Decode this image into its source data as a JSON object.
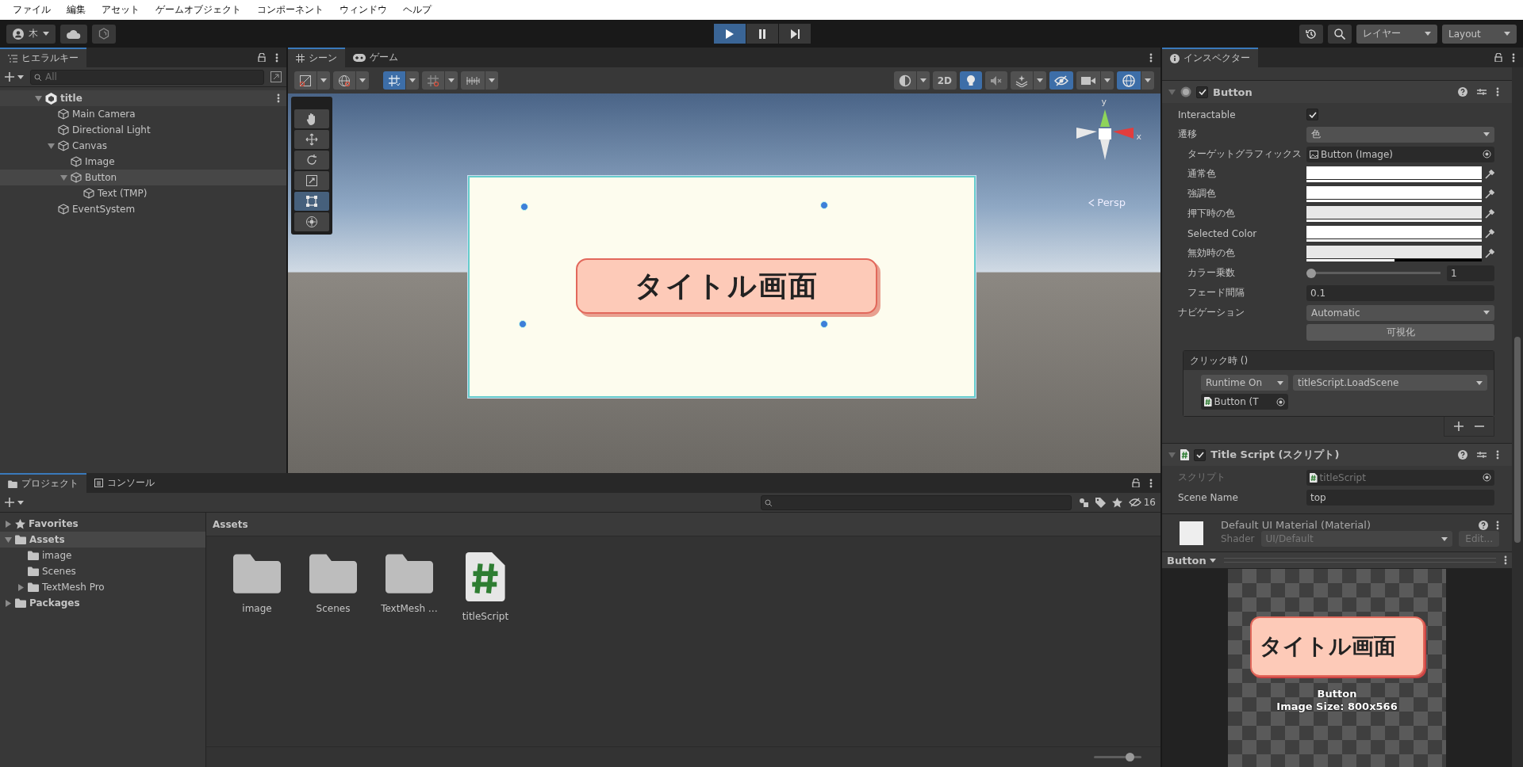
{
  "menu": [
    "ファイル",
    "編集",
    "アセット",
    "ゲームオブジェクト",
    "コンポーネント",
    "ウィンドウ",
    "ヘルプ"
  ],
  "toolbar": {
    "account": "木",
    "play_controls": [
      {
        "kind": "play",
        "selected": true
      },
      {
        "kind": "pause",
        "selected": false
      },
      {
        "kind": "step",
        "selected": false
      }
    ],
    "layers": "レイヤー",
    "layout": "Layout"
  },
  "hierarchy": {
    "tab": "ヒエラルキー",
    "search_placeholder": "All",
    "tree": [
      {
        "label": "title",
        "kind": "scene",
        "expanded": true,
        "selected": false,
        "children": [
          {
            "label": "Main Camera",
            "kind": "object",
            "selected": false
          },
          {
            "label": "Directional Light",
            "kind": "object",
            "selected": false
          },
          {
            "label": "Canvas",
            "kind": "object",
            "expanded": true,
            "selected": false,
            "children": [
              {
                "label": "Image",
                "kind": "object",
                "selected": false
              },
              {
                "label": "Button",
                "kind": "object",
                "expanded": true,
                "selected": true,
                "children": [
                  {
                    "label": "Text (TMP)",
                    "kind": "object",
                    "selected": false
                  }
                ]
              }
            ]
          },
          {
            "label": "EventSystem",
            "kind": "object",
            "selected": false
          }
        ]
      }
    ]
  },
  "scene": {
    "tabs": [
      {
        "label": "シーン",
        "kind": "scene",
        "selected": true
      },
      {
        "label": "ゲーム",
        "kind": "game",
        "selected": false
      }
    ],
    "toolbar": [
      {
        "kind": "shading",
        "on": false
      },
      {
        "kind": "globe",
        "on": false
      },
      {
        "kind": "grid",
        "on": true
      },
      {
        "kind": "snap",
        "on": false
      },
      {
        "kind": "increment",
        "on": false
      },
      {
        "kind": "render-mode",
        "on": false
      },
      {
        "kind": "dimension",
        "label": "2D",
        "on": false
      },
      {
        "kind": "lighting",
        "on": true
      },
      {
        "kind": "audio",
        "on": false
      },
      {
        "kind": "effects",
        "on": false
      },
      {
        "kind": "visibility",
        "on": true
      },
      {
        "kind": "camera",
        "on": false
      },
      {
        "kind": "gizmos",
        "on": true
      }
    ],
    "tools": [
      {
        "kind": "hand",
        "selected": false
      },
      {
        "kind": "move",
        "selected": false
      },
      {
        "kind": "rotate",
        "selected": false
      },
      {
        "kind": "scale",
        "selected": false
      },
      {
        "kind": "rect",
        "selected": true
      },
      {
        "kind": "transform",
        "selected": false
      }
    ],
    "button_text": "タイトル画面",
    "axis_labels": [
      "y",
      "x"
    ],
    "projection": "Persp"
  },
  "project": {
    "tabs": [
      {
        "label": "プロジェクト",
        "kind": "project",
        "selected": true
      },
      {
        "label": "コンソール",
        "kind": "console",
        "selected": false
      }
    ],
    "hidden_count": "16",
    "tree": [
      {
        "label": "Favorites",
        "kind": "favorites",
        "expanded": false,
        "selected": false
      },
      {
        "label": "Assets",
        "kind": "folder",
        "expanded": true,
        "selected": true,
        "children": [
          {
            "label": "image",
            "kind": "folder",
            "selected": false
          },
          {
            "label": "Scenes",
            "kind": "folder",
            "selected": false
          },
          {
            "label": "TextMesh Pro",
            "kind": "folder",
            "expanded": false,
            "selected": false
          }
        ]
      },
      {
        "label": "Packages",
        "kind": "folder",
        "expanded": false,
        "selected": false
      }
    ],
    "path": "Assets",
    "items": [
      {
        "name": "image",
        "kind": "folder"
      },
      {
        "name": "Scenes",
        "kind": "folder"
      },
      {
        "name": "TextMesh …",
        "kind": "folder"
      },
      {
        "name": "titleScript",
        "kind": "script"
      }
    ],
    "icon_size": {
      "level": 0.75
    }
  },
  "inspector": {
    "tab": "インスペクター",
    "components": [
      {
        "kind": "button",
        "title": "Button",
        "enabled": true,
        "fields": [
          {
            "kind": "checkbox",
            "label": "Interactable",
            "checked": true
          },
          {
            "kind": "dropdown",
            "label": "遷移",
            "value": "色",
            "children": [
              {
                "kind": "object",
                "label": "ターゲットグラフィックス",
                "value": "Button (Image)",
                "disabled": false
              },
              {
                "kind": "color",
                "label": "通常色",
                "color": "#ffffff",
                "level": 1
              },
              {
                "kind": "color",
                "label": "強調色",
                "color": "#ffffff",
                "level": 1
              },
              {
                "kind": "color",
                "label": "押下時の色",
                "color": "#e8e8e8",
                "level": 1
              },
              {
                "kind": "color",
                "label": "Selected Color",
                "color": "#ffffff",
                "level": 1
              },
              {
                "kind": "color",
                "label": "無効時の色",
                "color": "#e8e8e8",
                "level": 0.5
              },
              {
                "kind": "slider",
                "label": "カラー乗数",
                "level": 0,
                "value": "1"
              },
              {
                "kind": "text",
                "label": "フェード間隔",
                "value": "0.1"
              }
            ]
          },
          {
            "kind": "dropdown",
            "label": "ナビゲーション",
            "value": "Automatic"
          },
          {
            "kind": "button",
            "label": "可視化"
          }
        ],
        "event": {
          "title": "クリック時 ()",
          "mode": "Runtime On",
          "function": "titleScript.LoadScene",
          "target": "Button (T"
        }
      },
      {
        "kind": "script",
        "title": "Title Script (スクリプト)",
        "enabled": true,
        "fields": [
          {
            "kind": "object",
            "label": "スクリプト",
            "value": "titleScript",
            "disabled": true
          },
          {
            "kind": "text",
            "label": "Scene Name",
            "value": "top"
          }
        ]
      }
    ],
    "material": {
      "name": "Default UI Material (Material)",
      "shader_label": "Shader",
      "shader": "UI/Default",
      "edit": "Edit..."
    },
    "preview": {
      "selector": "Button",
      "image_text": "タイトル画面",
      "name": "Button",
      "size": "Image Size: 800x566"
    }
  }
}
